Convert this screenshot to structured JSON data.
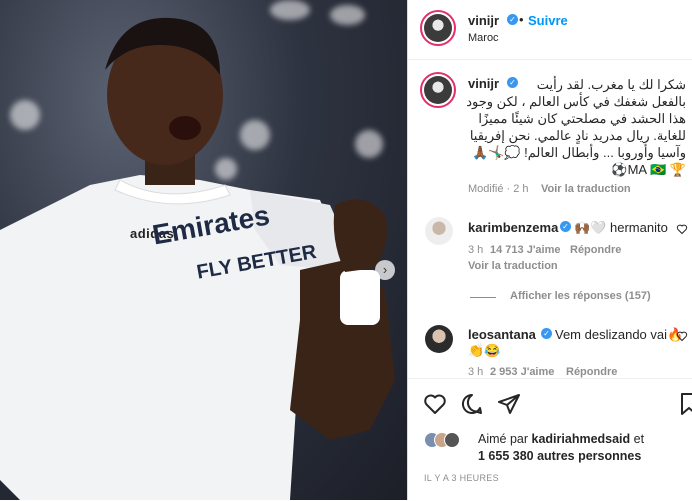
{
  "photo": {
    "jersey_sponsor_line1": "Emirates",
    "jersey_sponsor_line2": "FLY BETTER",
    "brand": "adidas"
  },
  "header": {
    "username": "vinijr",
    "follow_label": "Suivre",
    "location": "Maroc",
    "more_label": "..."
  },
  "caption": {
    "username": "vinijr",
    "lines": [
      "شكرا لك يا مغرب. لقد رأيت",
      "بالفعل شغفك في كأس العالم ، لكن وجود",
      "هذا الحشد في مصلحتي كان شيئًا مميزًا",
      "للغاية. ريال مدريد نادٍ عالمي. نحن إفريقيا",
      "وآسيا وأوروبا ... وأبطال العالم! 💭🤸🏾‍♂️🙏🏾",
      "🏆 MA 🇧🇷⚽"
    ],
    "meta_time": "Modifié · 2 h",
    "translate_label": "Voir la traduction"
  },
  "comments": [
    {
      "username": "karimbenzema",
      "text": "🙌🏾🤍 hermanito",
      "time": "3 h",
      "likes": "14 713 J'aime",
      "reply": "Répondre",
      "translate": "Voir la traduction",
      "view_replies": "Afficher les réponses (157)"
    },
    {
      "username": "leosantana",
      "text": "Vem deslizando vai🔥",
      "text2": "👏😂",
      "time": "3 h",
      "likes": "2 953 J'aime",
      "reply": "Répondre"
    }
  ],
  "likes": {
    "liked_by_prefix": "Aimé par",
    "liked_by_user": "kadiriahmedsaid",
    "and": "et",
    "others": "1 655 380 autres personnes"
  },
  "time_ago": "IL Y A 3 HEURES",
  "icons": {
    "heart": "heart-icon",
    "comment": "comment-icon",
    "share": "share-icon",
    "save": "bookmark-icon"
  },
  "colors": {
    "accent": "#0095f6",
    "verified": "#3897f0",
    "muted": "#8e8e8e"
  }
}
